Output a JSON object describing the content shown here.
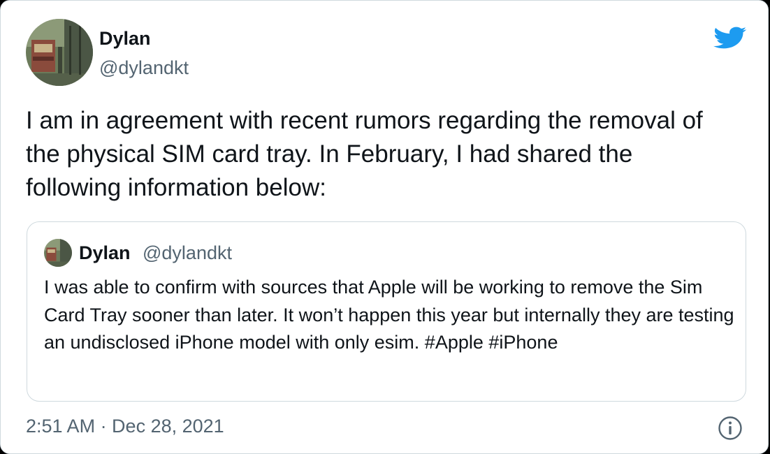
{
  "author": {
    "name": "Dylan",
    "handle": "@dylandkt",
    "avatar_icon": "profile-photo-train-scene"
  },
  "tweet": {
    "text": "I am in agreement with recent rumors regarding the removal of the physical SIM card tray. In February, I had shared the following information below:"
  },
  "quoted_tweet": {
    "name": "Dylan",
    "handle": "@dylandkt",
    "text": "I was able to confirm with sources that Apple will be working to remove the Sim Card Tray sooner than later. It won’t happen this year but internally they are testing an undisclosed iPhone model with only esim. #Apple #iPhone"
  },
  "timestamp": "2:51 AM · Dec 28, 2021",
  "icons": {
    "brand": "twitter-bird-icon",
    "info": "info-icon"
  },
  "colors": {
    "twitter_blue": "#1d9bf0",
    "text_primary": "#0f1419",
    "text_secondary": "#536471",
    "border": "#cfd9de"
  }
}
